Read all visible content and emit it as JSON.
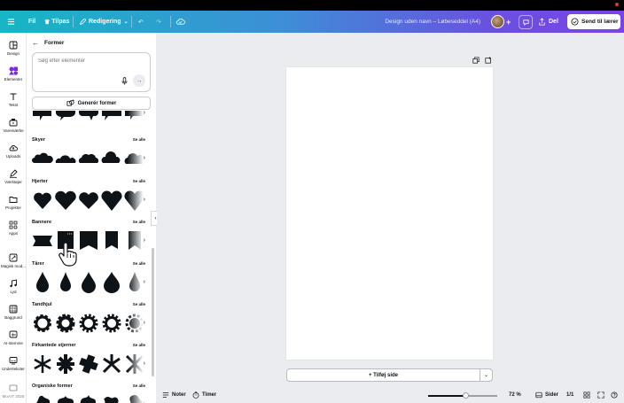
{
  "header": {
    "menu_icon": "hamburger-icon",
    "file_label": "Fil",
    "customize_label": "Tilpas",
    "editing_label": "Redigering",
    "document_title": "Design uden navn – Løbeseddel (A4)",
    "share_label": "Del",
    "send_label": "Send til lærer"
  },
  "rail": {
    "items": [
      {
        "label": "Design",
        "icon": "layout-icon"
      },
      {
        "label": "Elementer",
        "icon": "shapes-icon"
      },
      {
        "label": "Tekst",
        "icon": "text-icon"
      },
      {
        "label": "Varemærke",
        "icon": "brand-icon"
      },
      {
        "label": "Uploads",
        "icon": "cloud-upload-icon"
      },
      {
        "label": "Værktøjer",
        "icon": "pen-icon"
      },
      {
        "label": "Projekter",
        "icon": "folder-icon"
      },
      {
        "label": "Apps",
        "icon": "apps-icon"
      },
      {
        "label": "Magisk mod...",
        "icon": "magic-icon"
      },
      {
        "label": "Lyd",
        "icon": "music-icon"
      },
      {
        "label": "Baggrund",
        "icon": "background-icon"
      },
      {
        "label": "AI-stemme",
        "icon": "ai-voice-icon"
      },
      {
        "label": "Undertekster",
        "icon": "captions-icon"
      },
      {
        "label": "MoArT 2025",
        "icon": "folder-icon"
      }
    ]
  },
  "panel": {
    "title": "Former",
    "search_placeholder": "Søg efter elementer",
    "generate_label": "Generér former",
    "see_all": "Se alle",
    "sections": [
      {
        "title": "Skyer"
      },
      {
        "title": "Hjerter"
      },
      {
        "title": "Bannere"
      },
      {
        "title": "Tårer"
      },
      {
        "title": "Tandhjul"
      },
      {
        "title": "Firkantede stjerner"
      },
      {
        "title": "Organiske former"
      }
    ]
  },
  "canvas": {
    "add_page_label": "+ Tilføj side"
  },
  "bottombar": {
    "notes_label": "Noter",
    "timer_label": "Timer",
    "zoom_value": "72 %",
    "zoom_fraction": 0.55,
    "pages_label": "Sider",
    "page_count": "1/1"
  },
  "colors": {
    "accent": "#7d2ae8",
    "header_start": "#16b6c5",
    "header_end": "#7a43e8"
  }
}
